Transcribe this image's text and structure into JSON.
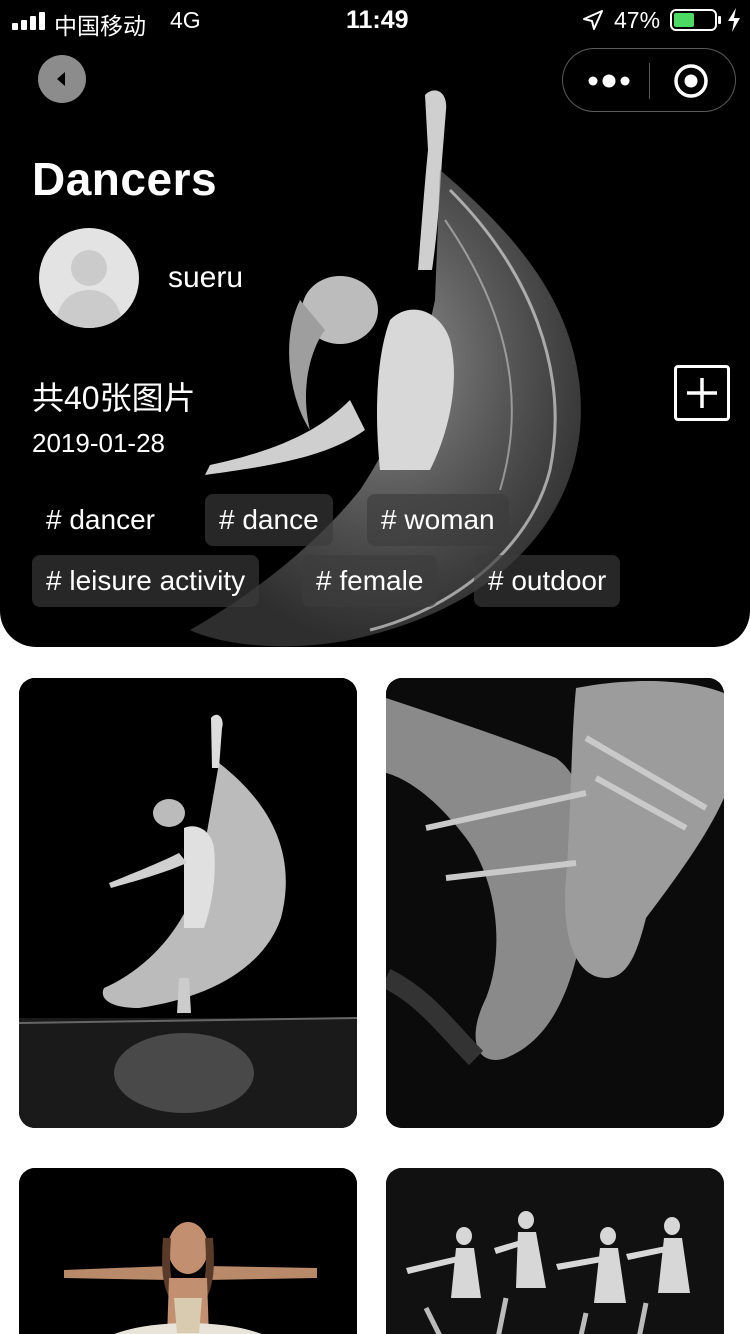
{
  "status_bar": {
    "carrier": "中国移动",
    "network": "4G",
    "time": "11:49",
    "battery": "47%",
    "battery_color": "#4cd964"
  },
  "header": {
    "title": "Dancers",
    "username": "sueru",
    "photo_count": "共40张图片",
    "date": "2019-01-28",
    "tags": [
      "# dancer",
      "# dance",
      "# woman",
      "# leisure activity",
      "# female",
      "# outdoor"
    ]
  },
  "icons": {
    "back": "back-arrow-icon",
    "more": "more-dots-icon",
    "target": "target-icon",
    "add": "plus-icon",
    "location": "location-arrow-icon",
    "avatar": "avatar-placeholder-icon"
  },
  "photos": [
    {
      "subject": "dancer-in-flowing-dress"
    },
    {
      "subject": "ballet-pointe-shoes"
    },
    {
      "subject": "ballerina-arms-spread"
    },
    {
      "subject": "dance-troupe"
    }
  ]
}
